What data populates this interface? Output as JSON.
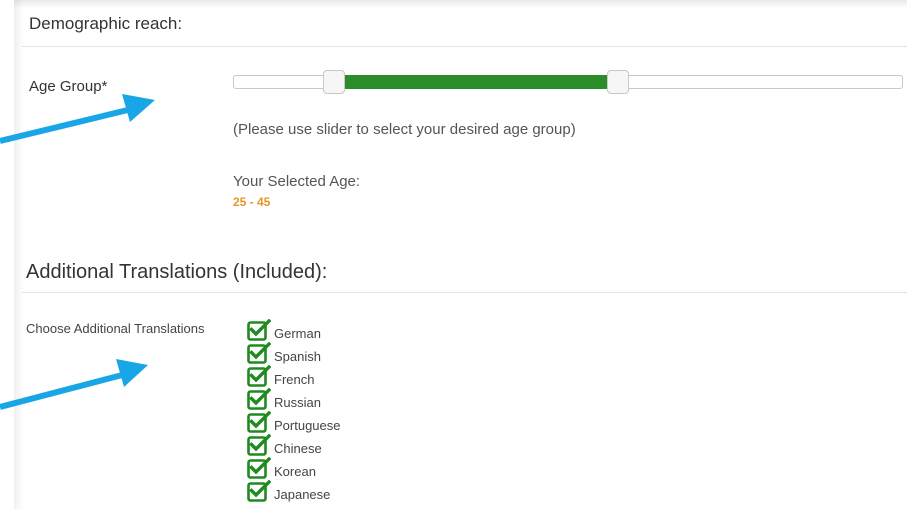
{
  "demographic": {
    "title": "Demographic reach:",
    "age_group_label": "Age Group*",
    "slider": {
      "min_value": 25,
      "max_value": 45
    },
    "help_text": "(Please use slider to select your desired age group)",
    "selected_age_label": "Your Selected Age:",
    "selected_age_value": "25 - 45"
  },
  "translations": {
    "title": "Additional Translations (Included):",
    "label": "Choose Additional Translations",
    "items": [
      {
        "label": "German",
        "checked": true
      },
      {
        "label": "Spanish",
        "checked": true
      },
      {
        "label": "French",
        "checked": true
      },
      {
        "label": "Russian",
        "checked": true
      },
      {
        "label": "Portuguese",
        "checked": true
      },
      {
        "label": "Chinese",
        "checked": true
      },
      {
        "label": "Korean",
        "checked": true
      },
      {
        "label": "Japanese",
        "checked": true
      }
    ]
  },
  "colors": {
    "slider_range": "#2a8d2a",
    "selected_age_value": "#e8962a",
    "checkbox": "#1f8a1f",
    "annotation_arrow": "#18a6e6"
  },
  "icons": {
    "checkbox": "checked-checkbox-icon",
    "annotation": "arrow-icon"
  }
}
